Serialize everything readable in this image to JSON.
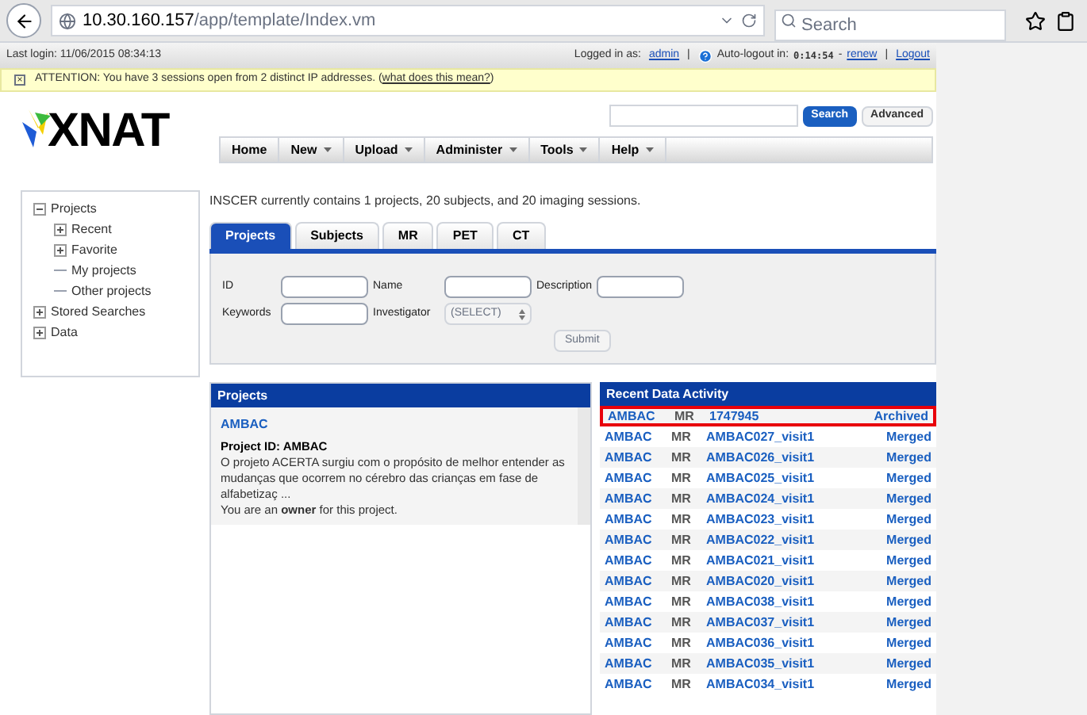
{
  "browser": {
    "url_host": "10.30.160.157",
    "url_path": "/app/template/Index.vm",
    "search_placeholder": "Search"
  },
  "top_bar": {
    "last_login": "Last login: 11/06/2015 08:34:13",
    "logged_in_label": "Logged in as:",
    "user": "admin",
    "separator_1": "|",
    "auto_logout_label": "Auto-logout in:",
    "timer": "0:14:54",
    "dash": "-",
    "renew": "renew",
    "separator_2": "|",
    "logout": "Logout"
  },
  "attention": {
    "close": "×",
    "text": "ATTENTION: You have 3 sessions open from 2 distinct IP addresses. (",
    "link": "what does this mean?",
    "closing": ")"
  },
  "header": {
    "logo": "XNAT",
    "search_button": "Search",
    "advanced_button": "Advanced"
  },
  "nav": [
    {
      "label": "Home",
      "dropdown": false
    },
    {
      "label": "New",
      "dropdown": true
    },
    {
      "label": "Upload",
      "dropdown": true
    },
    {
      "label": "Administer",
      "dropdown": true
    },
    {
      "label": "Tools",
      "dropdown": true
    },
    {
      "label": "Help",
      "dropdown": true
    }
  ],
  "tree": [
    {
      "label": "Projects",
      "kind": "branch",
      "expanded": true,
      "children": [
        {
          "label": "Recent",
          "kind": "branch",
          "expanded": false
        },
        {
          "label": "Favorite",
          "kind": "branch",
          "expanded": false
        },
        {
          "label": "My projects",
          "kind": "leaf"
        },
        {
          "label": "Other projects",
          "kind": "leaf"
        }
      ]
    },
    {
      "label": "Stored Searches",
      "kind": "branch",
      "expanded": false
    },
    {
      "label": "Data",
      "kind": "branch",
      "expanded": false
    }
  ],
  "intro": "INSCER currently contains 1 projects, 20 subjects, and 20 imaging sessions.",
  "tabs": [
    {
      "label": "Projects",
      "selected": true
    },
    {
      "label": "Subjects",
      "selected": false
    },
    {
      "label": "MR",
      "selected": false
    },
    {
      "label": "PET",
      "selected": false
    },
    {
      "label": "CT",
      "selected": false
    }
  ],
  "search_form": {
    "id_label": "ID",
    "name_label": "Name",
    "description_label": "Description",
    "keywords_label": "Keywords",
    "investigator_label": "Investigator",
    "investigator_value": "(SELECT)",
    "submit": "Submit"
  },
  "projects_panel": {
    "title": "Projects",
    "project_name": "AMBAC",
    "project_id": "Project ID: AMBAC",
    "description": "O projeto ACERTA surgiu com o propósito de melhor entender as mudanças que ocorrem no cérebro das crianças em fase de alfabetizaç ...",
    "role": "You are an **owner** for this project."
  },
  "recent_panel": {
    "title": "Recent Data Activity",
    "rows": [
      {
        "project": "AMBAC",
        "modality": "MR",
        "session": "1747945",
        "status": "Archived",
        "highlighted": true
      },
      {
        "project": "AMBAC",
        "modality": "MR",
        "session": "AMBAC027_visit1",
        "status": "Merged",
        "highlighted": false
      },
      {
        "project": "AMBAC",
        "modality": "MR",
        "session": "AMBAC026_visit1",
        "status": "Merged",
        "highlighted": false
      },
      {
        "project": "AMBAC",
        "modality": "MR",
        "session": "AMBAC025_visit1",
        "status": "Merged",
        "highlighted": false
      },
      {
        "project": "AMBAC",
        "modality": "MR",
        "session": "AMBAC024_visit1",
        "status": "Merged",
        "highlighted": false
      },
      {
        "project": "AMBAC",
        "modality": "MR",
        "session": "AMBAC023_visit1",
        "status": "Merged",
        "highlighted": false
      },
      {
        "project": "AMBAC",
        "modality": "MR",
        "session": "AMBAC022_visit1",
        "status": "Merged",
        "highlighted": false
      },
      {
        "project": "AMBAC",
        "modality": "MR",
        "session": "AMBAC021_visit1",
        "status": "Merged",
        "highlighted": false
      },
      {
        "project": "AMBAC",
        "modality": "MR",
        "session": "AMBAC020_visit1",
        "status": "Merged",
        "highlighted": false
      },
      {
        "project": "AMBAC",
        "modality": "MR",
        "session": "AMBAC038_visit1",
        "status": "Merged",
        "highlighted": false
      },
      {
        "project": "AMBAC",
        "modality": "MR",
        "session": "AMBAC037_visit1",
        "status": "Merged",
        "highlighted": false
      },
      {
        "project": "AMBAC",
        "modality": "MR",
        "session": "AMBAC036_visit1",
        "status": "Merged",
        "highlighted": false
      },
      {
        "project": "AMBAC",
        "modality": "MR",
        "session": "AMBAC035_visit1",
        "status": "Merged",
        "highlighted": false
      },
      {
        "project": "AMBAC",
        "modality": "MR",
        "session": "AMBAC034_visit1",
        "status": "Merged",
        "highlighted": false
      }
    ]
  }
}
